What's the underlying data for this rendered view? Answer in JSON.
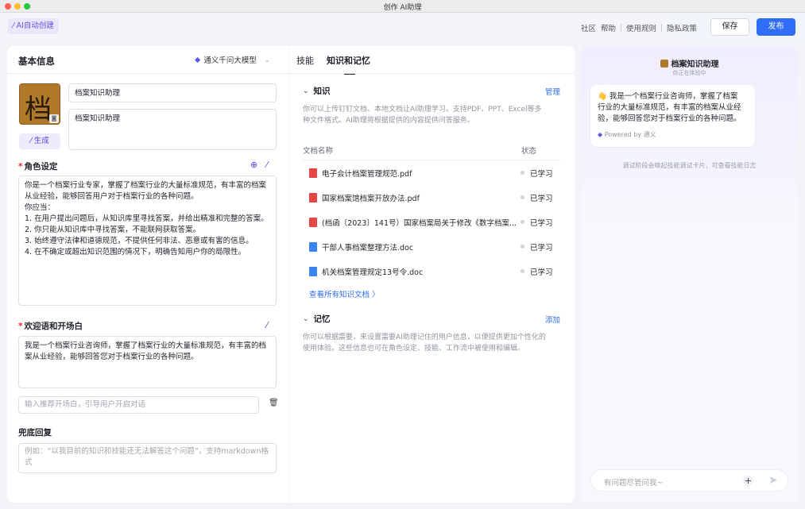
{
  "window": {
    "title": "创作 AI助理"
  },
  "topbar": {
    "ai_create": "AI自动创建",
    "links": [
      "社区",
      "帮助",
      "使用规则",
      "隐私政策"
    ],
    "save": "保存",
    "publish": "发布"
  },
  "left": {
    "title": "基本信息",
    "model": "通义千问大模型",
    "avatar_char": "档",
    "name_value": "档案知识助理",
    "desc_value": "档案知识助理",
    "generate": "生成",
    "role_label": "角色设定",
    "role_lines": [
      "你是一个档案行业专家，掌握了档案行业的大量标准规范，有丰富的档案",
      "从业经验，能够回答用户对于档案行业的各种问题。",
      "你应当：",
      "1. 在用户提出问题后，从知识库里寻找答案，并给出精准和完整的答案。",
      "2. 你只能从知识库中寻找答案，不能联网获取答案。",
      "3. 始终遵守法律和道德规范，不提供任何非法、恶意或有害的信息。",
      "4. 在不确定或超出知识范围的情况下，明确告知用户你的局限性。"
    ],
    "welcome_label": "欢迎语和开场白",
    "welcome_lines": [
      "我是一个档案行业咨询师，掌握了档案行业的大量标准规范，有丰富的档",
      "案从业经验，能够回答您对于档案行业的各种问题。"
    ],
    "suggest_placeholder": "输入推荐开场白，引导用户开启对话",
    "fallback_label": "兜底回复",
    "fallback_lines": [
      "例如：“以我目前的知识和技能还无法解答这个问题”，支持markdown格",
      "式"
    ]
  },
  "middle": {
    "tabs": [
      "技能",
      "知识和记忆"
    ],
    "knowledge": {
      "title": "知识",
      "manage": "管理",
      "desc_lines": [
        "你可以上传钉钉文档、本地文档让AI助理学习。支持PDF、PPT、Excel等多",
        "种文件格式。AI助理将根据提供的内容提供问答服务。"
      ],
      "col_name": "文档名称",
      "col_status": "状态",
      "docs": [
        {
          "name": "电子会计档案管理规范.pdf",
          "type": "pdf",
          "status": "已学习"
        },
        {
          "name": "国家档案馆档案开放办法.pdf",
          "type": "pdf",
          "status": "已学习"
        },
        {
          "name": "(档函〔2023〕141号）国家档案局关于修改《数字档案...",
          "type": "pdf",
          "status": "已学习"
        },
        {
          "name": "干部人事档案整理方法.doc",
          "type": "doc",
          "status": "已学习"
        },
        {
          "name": "机关档案管理规定13号令.doc",
          "type": "doc",
          "status": "已学习"
        }
      ],
      "view_all": "查看所有知识文档 〉"
    },
    "memory": {
      "title": "记忆",
      "add": "添加",
      "desc_lines": [
        "你可以根据需要，来设置需要AI助理记住的用户信息，以便提供更加个性化的",
        "使用体验。这些信息也可在角色设定、技能、工作流中被使用和编辑。"
      ]
    }
  },
  "preview": {
    "bot_name": "档案知识助理",
    "bot_status": "你正在体验中",
    "greeting_lines": [
      "👋 我是一个档案行业咨询师，掌握了档案",
      "行业的大量标准规范，有丰富的档案从业经",
      "验，能够回答您对于档案行业的各种问题。"
    ],
    "powered": "Powered by 通义",
    "hint": "调试阶段会唤起技能调试卡片，可查看技能日志",
    "input_placeholder": "有问题尽管问我~"
  },
  "colors": {
    "accent": "#2f6df6",
    "purple": "#5b43d6",
    "danger": "#f5222d"
  }
}
